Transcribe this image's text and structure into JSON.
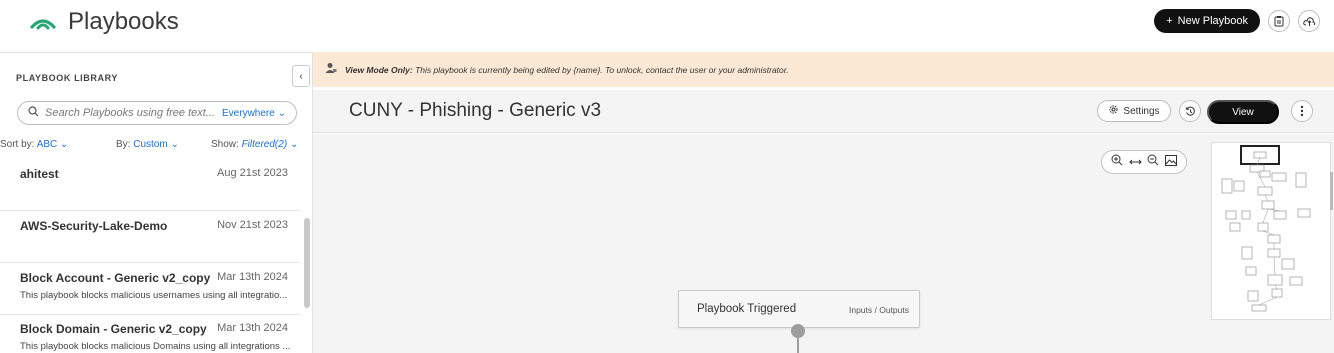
{
  "app": {
    "title": "Playbooks",
    "brand_color": "#2aa673",
    "new_playbook_label": "New Playbook"
  },
  "library": {
    "heading": "PLAYBOOK LIBRARY",
    "search_placeholder": "Search Playbooks using free text...",
    "search_scope": "Everywhere",
    "sort_label": "Sort by:",
    "sort_value": "ABC",
    "by_label": "By:",
    "by_value": "Custom",
    "show_label": "Show:",
    "show_value": "Filtered(2)",
    "items": [
      {
        "name": "ahitest",
        "date": "Aug 21st 2023",
        "description": ""
      },
      {
        "name": "AWS-Security-Lake-Demo",
        "date": "Nov 21st 2023",
        "description": ""
      },
      {
        "name": "Block Account - Generic v2_copy",
        "date": "Mar 13th 2024",
        "description": "This playbook blocks malicious usernames using all integratio..."
      },
      {
        "name": "Block Domain - Generic v2_copy",
        "date": "Mar 13th 2024",
        "description": "This playbook blocks malicious Domains using all integrations ..."
      }
    ]
  },
  "banner": {
    "bold": "View Mode Only:",
    "text": "This playbook is currently being edited by {name}. To unlock, contact the user or your administrator.",
    "background": "#fbe9d6"
  },
  "editor": {
    "playbook_title": "CUNY - Phishing - Generic v3",
    "settings_label": "Settings",
    "view_label": "View"
  },
  "canvas": {
    "node_title": "Playbook Triggered",
    "node_link": "Inputs / Outputs"
  }
}
